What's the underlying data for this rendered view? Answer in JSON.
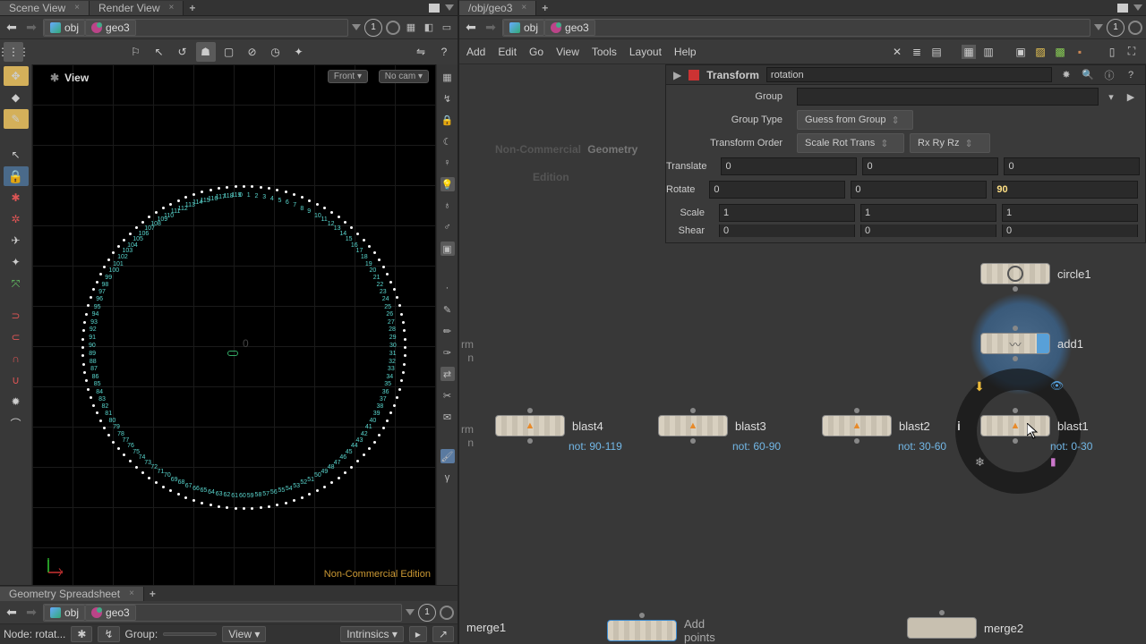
{
  "left": {
    "tabs": [
      {
        "label": "Scene View",
        "active": true
      },
      {
        "label": "Render View",
        "active": false
      }
    ],
    "path": {
      "obj": "obj",
      "geo": "geo3",
      "circ": "1"
    },
    "view_label": "View",
    "cam1": "Front ▾",
    "cam2": "No cam ▾",
    "origin": "0",
    "watermark": "Non-Commercial Edition",
    "spreadsheet_tab": "Geometry Spreadsheet",
    "spreadsheet_path": {
      "obj": "obj",
      "geo": "geo3",
      "circ": "1"
    },
    "sb": {
      "node": "Node: rotat...",
      "group": "Group:",
      "view": "View",
      "intr": "Intrinsics"
    }
  },
  "right": {
    "tab": "/obj/geo3",
    "path": {
      "obj": "obj",
      "geo": "geo3",
      "circ": "1"
    },
    "menu": [
      "Add",
      "Edit",
      "Go",
      "View",
      "Tools",
      "Layout",
      "Help"
    ],
    "parm": {
      "op": "Transform",
      "name": "rotation",
      "labels": {
        "group": "Group",
        "grouptype": "Group Type",
        "xord": "Transform Order",
        "t": "Translate",
        "r": "Rotate",
        "s": "Scale",
        "sh": "Shear"
      },
      "grouptype_val": "Guess from Group",
      "xord_val": "Scale Rot Trans",
      "rord_val": "Rx Ry Rz",
      "t": [
        "0",
        "0",
        "0"
      ],
      "r": [
        "0",
        "0",
        "90"
      ],
      "s": [
        "1",
        "1",
        "1"
      ],
      "sh": [
        "0",
        "0",
        "0"
      ]
    },
    "watermark1": "Non-Commercial",
    "watermark2": "Edition",
    "watermark3": "Geometry",
    "nodes": {
      "circle1": "circle1",
      "add1": "add1",
      "blast1": "blast1",
      "blast1_sub": "not: 0-30",
      "blast2": "blast2",
      "blast2_sub": "not: 30-60",
      "blast3": "blast3",
      "blast3_sub": "not: 60-90",
      "blast4": "blast4",
      "blast4_sub": "not: 90-119",
      "merge1": "merge1",
      "merge2": "merge2",
      "addpts": "Add\npoints",
      "rm": "rm",
      "n": "n"
    }
  }
}
